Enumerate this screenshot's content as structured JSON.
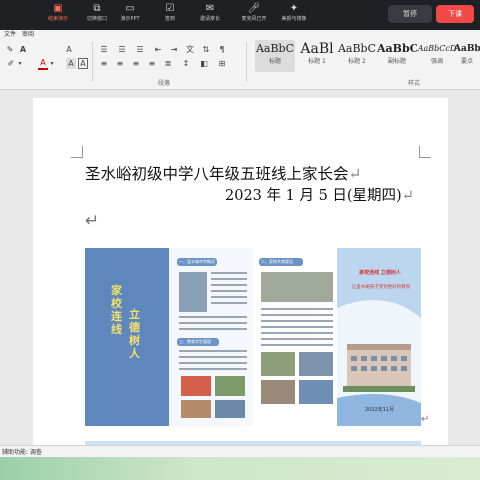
{
  "meeting_bar": {
    "items": [
      {
        "label": "结束演示",
        "icon": "share-screen-icon"
      },
      {
        "label": "切换窗口",
        "icon": "switch-window-icon"
      },
      {
        "label": "演示PPT",
        "icon": "ppt-icon"
      },
      {
        "label": "签到",
        "icon": "check-in-icon"
      },
      {
        "label": "邀请家长",
        "icon": "invite-icon"
      },
      {
        "label": "麦克风已开",
        "icon": "microphone-icon"
      },
      {
        "label": "美颜与镜像",
        "icon": "beauty-icon"
      }
    ],
    "pause_label": "暂停",
    "end_label": "下课",
    "active_color": "#ef4a48"
  },
  "ribbon": {
    "tabs": [
      "文件",
      "审阅"
    ],
    "group_paragraph": "段落",
    "group_styles": "样式",
    "styles": [
      {
        "sample": "AaBbC",
        "name": "标题"
      },
      {
        "sample": "AaBl",
        "name": "标题 1"
      },
      {
        "sample": "AaBbC",
        "name": "标题 2"
      },
      {
        "sample": "AaBbC",
        "name": "副标题"
      },
      {
        "sample": "AaBbCcD",
        "name": "强调"
      },
      {
        "sample": "AaBb",
        "name": "要点"
      }
    ]
  },
  "document": {
    "title": "圣水峪初级中学八年级五班线上家长会",
    "date": "2023 年 1 月 5 日(星期四)",
    "paragraph_mark": "↵",
    "brochure": {
      "vertical_text_1": "立德树人",
      "vertical_text_2": "家校连线",
      "slogan_1": "家校连线  立德树人",
      "slogan_2": "让圣水峪孩子受到更好的教育",
      "date": "2022年11月",
      "heading_1": "一、圣水峪中学概况",
      "heading_2": "二、家校共育理念",
      "heading_3": "三、德育学生管理"
    }
  },
  "status_bar": {
    "accessibility": "辅助功能: 调查"
  }
}
